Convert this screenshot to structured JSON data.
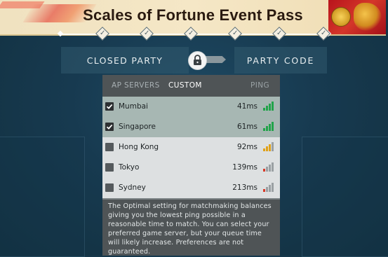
{
  "event_pass": {
    "title": "Scales of Fortune Event Pass",
    "milestone_icon": "check-icon"
  },
  "party": {
    "closed_label": "CLOSED PARTY",
    "code_label": "PARTY CODE",
    "lock_icon": "lock-icon"
  },
  "servers": {
    "tabs": {
      "region": "AP SERVERS",
      "custom": "CUSTOM",
      "ping": "PING"
    },
    "rows": [
      {
        "name": "Mumbai",
        "ping": "41ms",
        "checked": true,
        "signal": 4,
        "signal_color": "#22a34a"
      },
      {
        "name": "Singapore",
        "ping": "61ms",
        "checked": true,
        "signal": 4,
        "signal_color": "#22a34a"
      },
      {
        "name": "Hong Kong",
        "ping": "92ms",
        "checked": false,
        "signal": 3,
        "signal_color": "#e0a21a"
      },
      {
        "name": "Tokyo",
        "ping": "139ms",
        "checked": false,
        "signal": 1,
        "signal_color": "#d83a2a"
      },
      {
        "name": "Sydney",
        "ping": "213ms",
        "checked": false,
        "signal": 1,
        "signal_color": "#d83a2a"
      }
    ],
    "info_text": "The Optimal setting for matchmaking balances giving you the lowest ping possible in a reasonable time to match. You can select your preferred game server, but your queue time will likely increase. Preferences are not guaranteed."
  },
  "colors": {
    "background": "#173a50",
    "checked_row": "#a7b7b3",
    "unchecked_row": "#dde0e1",
    "panel_header": "#4f5456"
  }
}
